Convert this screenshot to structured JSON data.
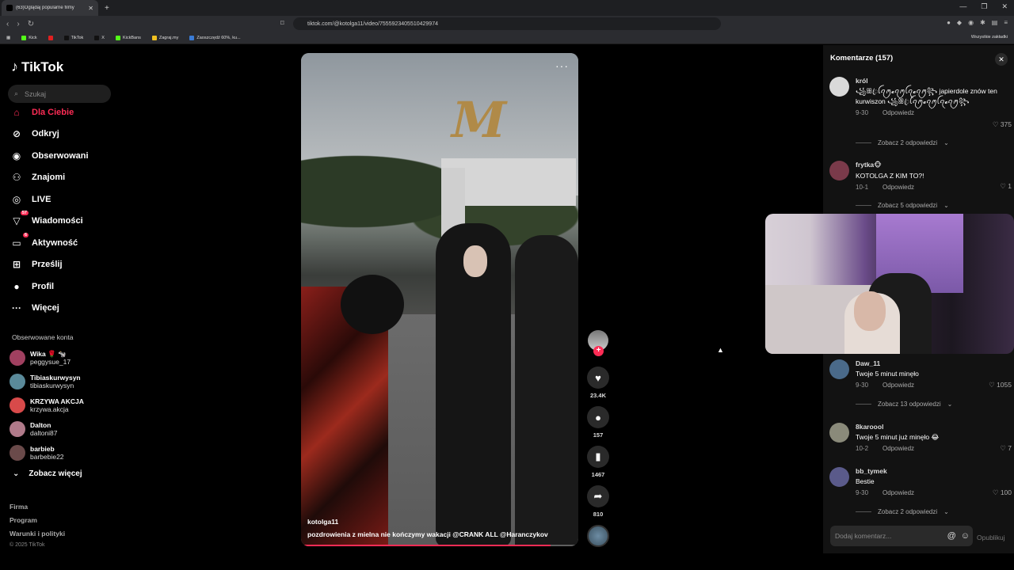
{
  "browser": {
    "tab_title": "(63)Oglądaj popularne filmy",
    "url": "tiktok.com/@kotolga11/video/7555923405510429974",
    "bookmarks": [
      {
        "label": "Kick",
        "color": "#53fc18"
      },
      {
        "label": "",
        "color": "#e02020"
      },
      {
        "label": "TikTok",
        "color": "#000000"
      },
      {
        "label": "X",
        "color": "#000000"
      },
      {
        "label": "KickBans",
        "color": "#53fc18"
      },
      {
        "label": "Zagraj.my",
        "color": "#f0c020"
      },
      {
        "label": "Zaoszczędź 60%, ku...",
        "color": "#3a7bd5"
      }
    ],
    "all_bookmarks": "Wszystkie zakładki"
  },
  "sidebar": {
    "logo": "TikTok",
    "search_placeholder": "Szukaj",
    "nav": [
      {
        "label": "Dla Ciebie",
        "icon": "home-icon",
        "active": true
      },
      {
        "label": "Odkryj",
        "icon": "compass-icon"
      },
      {
        "label": "Obserwowani",
        "icon": "following-icon"
      },
      {
        "label": "Znajomi",
        "icon": "friends-icon"
      },
      {
        "label": "LIVE",
        "icon": "live-icon"
      },
      {
        "label": "Wiadomości",
        "icon": "messages-icon",
        "badge": "57"
      },
      {
        "label": "Aktywność",
        "icon": "activity-icon",
        "badge": "6"
      },
      {
        "label": "Prześlij",
        "icon": "upload-icon"
      },
      {
        "label": "Profil",
        "icon": "profile-icon"
      },
      {
        "label": "Więcej",
        "icon": "more-icon"
      }
    ],
    "followed_title": "Obserwowane konta",
    "accounts": [
      {
        "name": "Wika 🌹 🐄",
        "handle": "peggysue_17",
        "color": "#a04060"
      },
      {
        "name": "Tibiaskurwysyn",
        "handle": "tibiaskurwysyn",
        "color": "#5a8a9a"
      },
      {
        "name": "KRZYWA AKCJA",
        "handle": "krzywa.akcja",
        "color": "#d84a4a"
      },
      {
        "name": "Dalton",
        "handle": "daltoni87",
        "color": "#b07a8a"
      },
      {
        "name": "barbieb",
        "handle": "barbebie22",
        "color": "#6a4a4a"
      }
    ],
    "see_more": "Zobacz więcej",
    "footer": [
      "Firma",
      "Program",
      "Warunki i polityki"
    ],
    "copyright": "© 2025 TikTok"
  },
  "video": {
    "username": "kotolga11",
    "caption": "pozdrowienia z mielna nie kończymy wakacji @CRANK ALL  @Haranczykov",
    "progress": 0.9,
    "sign_letter": "M"
  },
  "actions": {
    "likes": "23.4K",
    "comments": "157",
    "saves": "1467",
    "shares": "810"
  },
  "comments_panel": {
    "title": "Komentarze (157)",
    "reply_label": "Odpowiedz",
    "input_placeholder": "Dodaj komentarz...",
    "post_label": "Opublikuj",
    "items": [
      {
        "user": "król",
        "text": "꧁ꕥꦿꪶꪖꪑ𝓮ꪖꪑꪶꪖ𝓮ꪖꪑ꧂ japierdole znów ten kurwiszon ꧁ꕥꦿꪶꪖꪑ𝓮ꪖꪑꪶꪖ𝓮ꪖꪑ꧂",
        "date": "9-30",
        "likes": "375",
        "replies": "Zobacz 2 odpowiedzi",
        "color": "#d9d9d9"
      },
      {
        "user": "frytka🐵",
        "text": "KOTOLGA Z KIM TO?!",
        "date": "10-1",
        "likes": "1",
        "replies": "Zobacz 5 odpowiedzi",
        "color": "#7a3a4a"
      },
      {
        "user": "Daw_11",
        "text": "Twoje 5 minut minęło",
        "date": "9-30",
        "likes": "1055",
        "replies": "Zobacz 13 odpowiedzi",
        "color": "#4a6a8a"
      },
      {
        "user": "8karoool",
        "text": "Twoje 5 minut już minęło 😂",
        "date": "10-2",
        "likes": "7",
        "replies": "",
        "color": "#8a8a7a"
      },
      {
        "user": "bb_tymek",
        "text": "Bestie",
        "date": "9-30",
        "likes": "100",
        "replies": "Zobacz 2 odpowiedzi",
        "color": "#5a5a8a"
      }
    ]
  }
}
